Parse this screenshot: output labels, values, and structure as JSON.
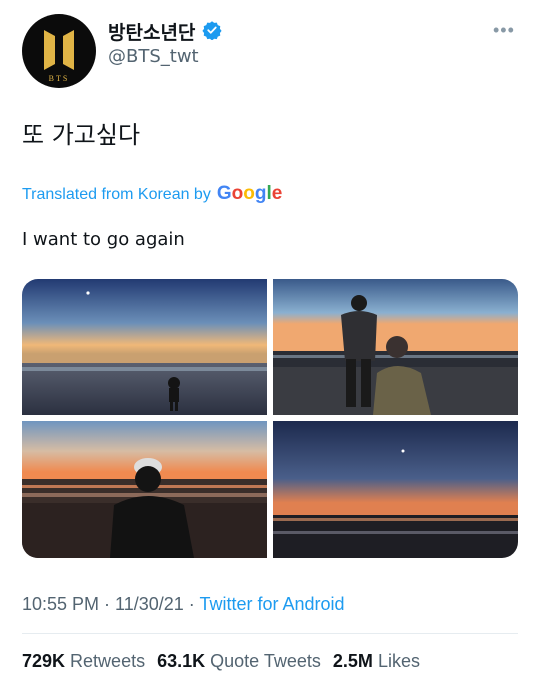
{
  "author": {
    "display_name": "방탄소년단",
    "handle": "@BTS_twt",
    "logo_text": "BTS",
    "verified": true
  },
  "tweet": {
    "text": "또 가고싶다",
    "translated_from": "Translated from Korean by",
    "translator": "Google",
    "translation": "I want to go again"
  },
  "photos": [
    {
      "id": "beach-sunset-standing-figure"
    },
    {
      "id": "beach-two-people"
    },
    {
      "id": "beach-seated-figure"
    },
    {
      "id": "beach-horizon-dusk"
    }
  ],
  "meta": {
    "time": "10:55 PM",
    "separator": " · ",
    "date": "11/30/21",
    "source": "Twitter for Android"
  },
  "stats": {
    "retweets_count": "729K",
    "retweets_label": "Retweets",
    "quotes_count": "63.1K",
    "quotes_label": "Quote Tweets",
    "likes_count": "2.5M",
    "likes_label": "Likes"
  },
  "colors": {
    "accent": "#1d9bf0",
    "secondary_text": "#536471",
    "logo_gold": "#e0b446"
  },
  "icons": [
    "verified-badge-icon",
    "more-options-icon",
    "bts-logo"
  ]
}
